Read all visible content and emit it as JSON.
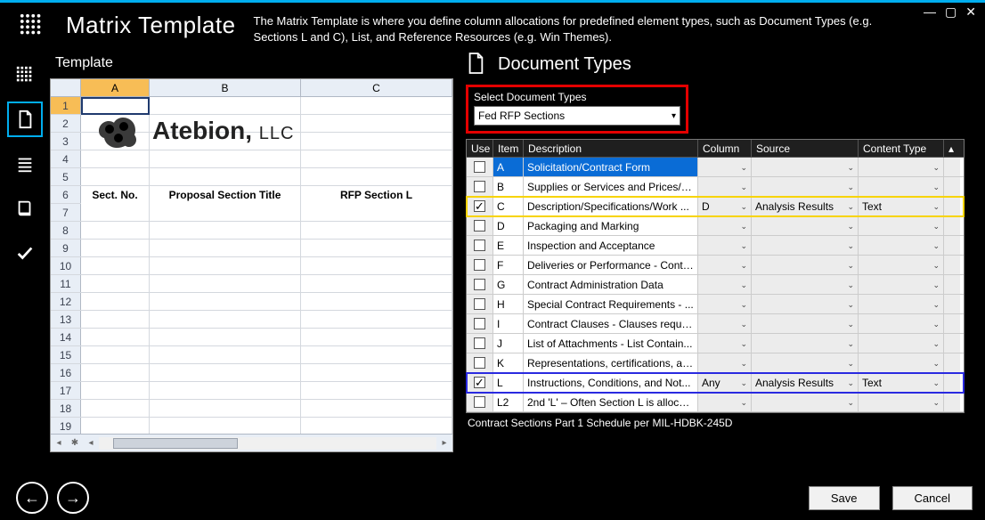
{
  "app": {
    "title": "Matrix Template",
    "description": "The Matrix Template is where you define column allocations for predefined element types, such as Document Types (e.g. Sections L and C), List, and Reference Resources (e.g. Win Themes)."
  },
  "sidebar": {
    "items": [
      {
        "name": "matrix-icon"
      },
      {
        "name": "document-icon"
      },
      {
        "name": "list-icon"
      },
      {
        "name": "book-icon"
      },
      {
        "name": "check-icon"
      }
    ],
    "selected_index": 1
  },
  "template_panel": {
    "title": "Template",
    "columns": [
      "A",
      "B",
      "C"
    ],
    "headers_row": 6,
    "header_labels": {
      "A": "Sect. No.",
      "B": "Proposal Section Title",
      "C": "RFP Section L"
    },
    "logo_text_main": "Atebion,",
    "logo_text_suffix": "LLC",
    "visible_rows": 19
  },
  "doc_types_panel": {
    "title": "Document Types",
    "select_label": "Select Document Types",
    "select_value": "Fed RFP Sections",
    "grid_headers": {
      "use": "Use",
      "item": "Item",
      "desc": "Description",
      "col": "Column",
      "src": "Source",
      "ct": "Content Type"
    },
    "rows": [
      {
        "use": false,
        "item": "A",
        "desc": "Solicitation/Contract Form",
        "col": "",
        "src": "",
        "ct": "",
        "selected": true
      },
      {
        "use": false,
        "item": "B",
        "desc": "Supplies or Services and Prices/C...",
        "col": "",
        "src": "",
        "ct": ""
      },
      {
        "use": true,
        "item": "C",
        "desc": "Description/Specifications/Work ...",
        "col": "D",
        "src": "Analysis Results",
        "ct": "Text",
        "highlight": "yellow"
      },
      {
        "use": false,
        "item": "D",
        "desc": "Packaging and Marking",
        "col": "",
        "src": "",
        "ct": ""
      },
      {
        "use": false,
        "item": "E",
        "desc": "Inspection and Acceptance",
        "col": "",
        "src": "",
        "ct": ""
      },
      {
        "use": false,
        "item": "F",
        "desc": "Deliveries or Performance - Contr...",
        "col": "",
        "src": "",
        "ct": ""
      },
      {
        "use": false,
        "item": "G",
        "desc": "Contract Administration Data",
        "col": "",
        "src": "",
        "ct": ""
      },
      {
        "use": false,
        "item": "H",
        "desc": "Special Contract Requirements - ...",
        "col": "",
        "src": "",
        "ct": ""
      },
      {
        "use": false,
        "item": "I",
        "desc": "Contract Clauses - Clauses requir...",
        "col": "",
        "src": "",
        "ct": ""
      },
      {
        "use": false,
        "item": "J",
        "desc": "List of Attachments - List Contain...",
        "col": "",
        "src": "",
        "ct": ""
      },
      {
        "use": false,
        "item": "K",
        "desc": "Representations, certifications, an...",
        "col": "",
        "src": "",
        "ct": ""
      },
      {
        "use": true,
        "item": "L",
        "desc": "Instructions, Conditions, and Not...",
        "col": "Any",
        "src": "Analysis Results",
        "ct": "Text",
        "highlight": "blue"
      },
      {
        "use": false,
        "item": "L2",
        "desc": "2nd 'L' – Often Section L is allocat...",
        "col": "",
        "src": "",
        "ct": ""
      }
    ],
    "footer_text": "Contract Sections Part 1 Schedule per MIL-HDBK-245D"
  },
  "footer": {
    "save_label": "Save",
    "cancel_label": "Cancel"
  }
}
